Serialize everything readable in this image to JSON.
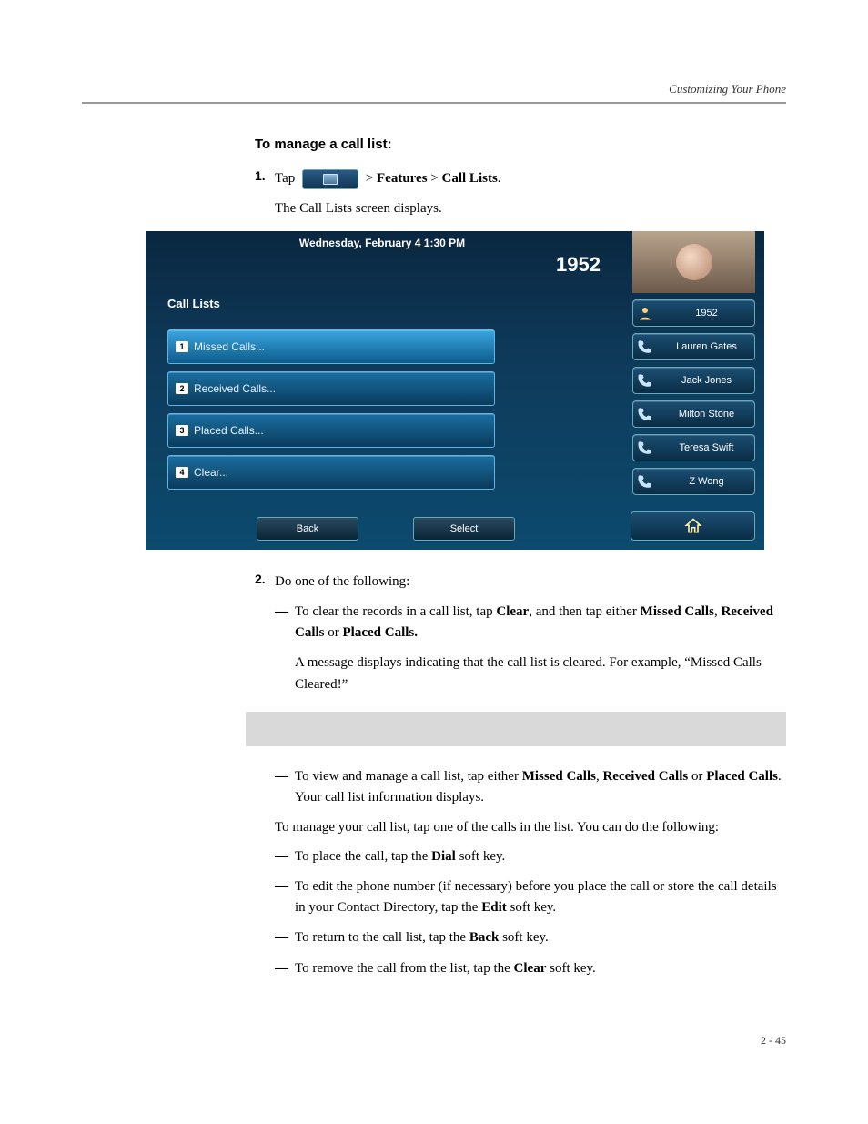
{
  "header": {
    "section": "Customizing Your Phone"
  },
  "title": "To manage a call list:",
  "step1": {
    "num": "1.",
    "pre": "Tap",
    "post_prefix": " >",
    "features": "Features",
    "gt": " > ",
    "calllists": "Call Lists",
    "period": ".",
    "sub": "The Call Lists screen displays."
  },
  "shot": {
    "datetime": "Wednesday, February 4  1:30 PM",
    "ext": "1952",
    "title": "Call Lists",
    "rows": [
      {
        "n": "1",
        "label": "Missed Calls..."
      },
      {
        "n": "2",
        "label": "Received Calls..."
      },
      {
        "n": "3",
        "label": "Placed Calls..."
      },
      {
        "n": "4",
        "label": "Clear..."
      }
    ],
    "softkeys": {
      "back": "Back",
      "select": "Select"
    },
    "contacts": {
      "ext_pill": "1952",
      "items": [
        "Lauren Gates",
        "Jack Jones",
        "Milton Stone",
        "Teresa Swift",
        "Z Wong"
      ]
    }
  },
  "step2": {
    "num": "2.",
    "lead": "Do one of the following:",
    "dash": "—",
    "sub1a": "To clear the records in a call list, tap ",
    "clear": "Clear",
    "sub1b": ", and then tap either ",
    "missed": "Missed Calls",
    "comma": ", ",
    "received": "Received Calls",
    "or": " or ",
    "placed": "Placed Calls.",
    "msg": "A message displays indicating that the call list is cleared. For example, “Missed Calls Cleared!”",
    "sub2a": "To view and manage a call list, tap either ",
    "sub2b": ". Your call list information displays.",
    "placed2": "Placed Calls",
    "manage": "To manage your call list, tap one of the calls in the list. You can do the following:",
    "d1a": "To place the call, tap the ",
    "dial": "Dial",
    "skey": " soft key.",
    "d2a": "To edit the phone number (if necessary) before you place the call or store the call details in your Contact Directory, tap the ",
    "edit": "Edit",
    "d3a": "To return to the call list, tap the ",
    "back": "Back",
    "d4a": "To remove the call from the list, tap the ",
    "clear2": "Clear"
  },
  "footer": "2 - 45"
}
